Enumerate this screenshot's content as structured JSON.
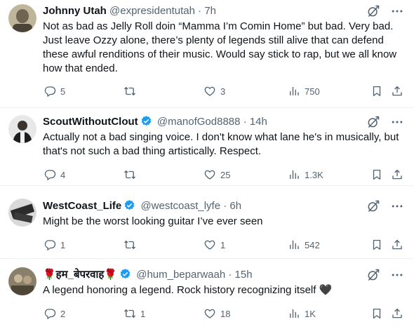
{
  "tweets": [
    {
      "name": "Johnny Utah",
      "handle": "@expresidentutah",
      "time": "7h",
      "verified": false,
      "text": "Not as bad as Jelly Roll doin “Mamma I’m Comin Home” but bad. Very bad. Just leave Ozzy alone, there’s plenty of legends still alive that can defend these awful renditions of their music. Would say stick to rap, but we all know how that ended.",
      "replies": "5",
      "reposts": "",
      "likes": "3",
      "views": "750"
    },
    {
      "name": "ScoutWithoutClout",
      "handle": "@manofGod8888",
      "time": "14h",
      "verified": true,
      "text": "Actually not a bad singing voice. I don't know what lane he's in musically, but that's not such a bad thing artistically. Respect.",
      "replies": "4",
      "reposts": "",
      "likes": "25",
      "views": "1.3K"
    },
    {
      "name": "WestCoast_Life",
      "handle": "@westcoast_lyfe",
      "time": "6h",
      "verified": true,
      "text": "Might be the worst looking guitar I’ve ever seen",
      "replies": "1",
      "reposts": "",
      "likes": "1",
      "views": "542"
    },
    {
      "name": "🌹हम_बेपरवाह🌹",
      "handle": "@hum_beparwaah",
      "time": "15h",
      "verified": true,
      "text": "A legend honoring a legend. Rock history recognizing itself 🖤",
      "replies": "2",
      "reposts": "1",
      "likes": "18",
      "views": "1K"
    }
  ],
  "colors": {
    "text": "#0f1419",
    "muted": "#536471",
    "verified": "#1d9bf0",
    "divider": "#eff3f4"
  },
  "icons": [
    "grok-icon",
    "more-icon",
    "reply-icon",
    "repost-icon",
    "like-icon",
    "views-icon",
    "bookmark-icon",
    "share-icon",
    "verified-badge-icon"
  ]
}
